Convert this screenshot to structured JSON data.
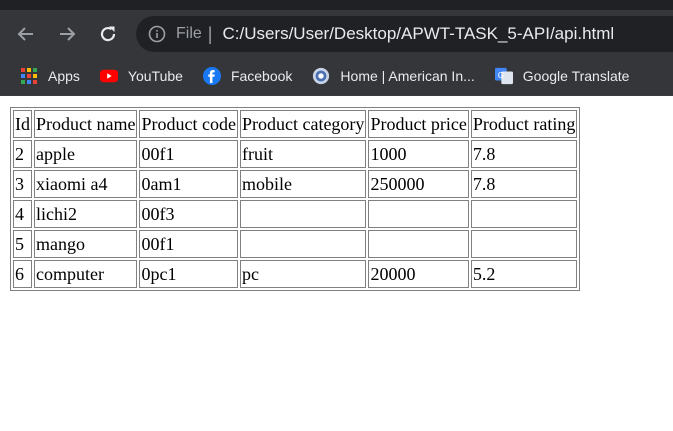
{
  "browser": {
    "file_label": "File",
    "url": "C:/Users/User/Desktop/APWT-TASK_5-API/api.html"
  },
  "bookmarks": [
    {
      "label": "Apps",
      "icon": "apps-grid-icon"
    },
    {
      "label": "YouTube",
      "icon": "youtube-icon"
    },
    {
      "label": "Facebook",
      "icon": "facebook-icon"
    },
    {
      "label": "Home | American In...",
      "icon": "globe-icon"
    },
    {
      "label": "Google Translate",
      "icon": "google-translate-icon"
    }
  ],
  "table": {
    "headers": [
      "Id",
      "Product name",
      "Product code",
      "Product category",
      "Product price",
      "Product rating"
    ],
    "rows": [
      [
        "2",
        "apple",
        "00f1",
        "fruit",
        "1000",
        "7.8"
      ],
      [
        "3",
        "xiaomi a4",
        "0am1",
        "mobile",
        "250000",
        "7.8"
      ],
      [
        "4",
        "lichi2",
        "00f3",
        "",
        "",
        ""
      ],
      [
        "5",
        "mango",
        "00f1",
        "",
        "",
        ""
      ],
      [
        "6",
        "computer",
        "0pc1",
        "pc",
        "20000",
        "5.2"
      ]
    ]
  },
  "colors": {
    "chrome_dark": "#202124",
    "toolbar": "#35363a",
    "youtube_red": "#ff0000",
    "facebook_blue": "#1877f2"
  }
}
